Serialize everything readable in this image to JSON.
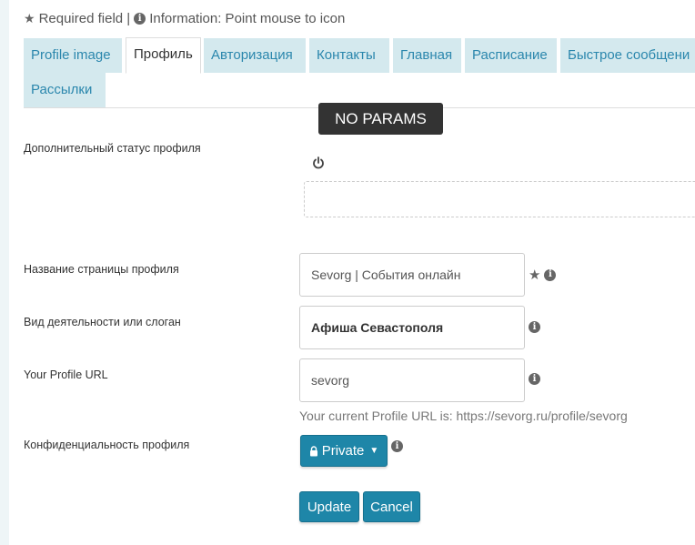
{
  "info_line": {
    "required_text": "Required field |",
    "information_text": "Information: Point mouse to icon"
  },
  "tabs": [
    {
      "label": "Profile image",
      "active": false
    },
    {
      "label": "Профиль",
      "active": true
    },
    {
      "label": "Авторизация",
      "active": false
    },
    {
      "label": "Контакты",
      "active": false
    },
    {
      "label": "Главная",
      "active": false
    },
    {
      "label": "Расписание",
      "active": false
    },
    {
      "label": "Быстрое сообщени",
      "active": false
    },
    {
      "label": "Рассылки",
      "active": false
    }
  ],
  "overlay": {
    "no_params": "NO PARAMS"
  },
  "form": {
    "extra_status": {
      "label": "Дополнительный статус профиля",
      "icon": "power-icon"
    },
    "page_name": {
      "label": "Название страницы профиля",
      "value": "Sevorg | События онлайн"
    },
    "activity": {
      "label": "Вид деятельности или слоган",
      "value": "Афиша Севастополя"
    },
    "profile_url": {
      "label": "Your Profile URL",
      "value": "sevorg",
      "helper": "Your current Profile URL is: https://sevorg.ru/profile/sevorg"
    },
    "privacy": {
      "label": "Конфиденциальность профиля",
      "value": "Private"
    }
  },
  "buttons": {
    "update": "Update",
    "cancel": "Cancel"
  },
  "colors": {
    "tab_bg": "#d4e9ee",
    "tab_text": "#2b87ad",
    "primary": "#1e86a8",
    "overlay_bg": "#333333"
  }
}
